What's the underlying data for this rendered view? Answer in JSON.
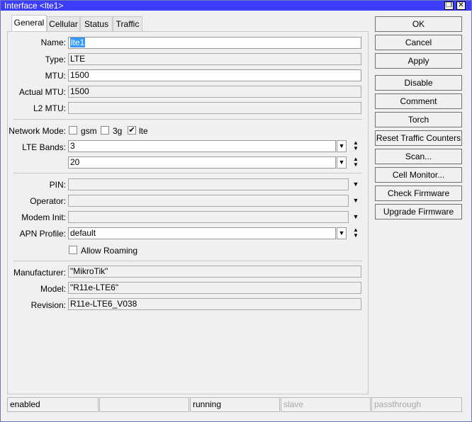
{
  "window": {
    "title": "Interface <lte1>",
    "restore_glyph": "❐",
    "close_glyph": "✕"
  },
  "tabs": [
    {
      "label": "General"
    },
    {
      "label": "Cellular"
    },
    {
      "label": "Status"
    },
    {
      "label": "Traffic"
    }
  ],
  "general": {
    "name": {
      "label": "Name:",
      "value": "lte1"
    },
    "type": {
      "label": "Type:",
      "value": "LTE"
    },
    "mtu": {
      "label": "MTU:",
      "value": "1500"
    },
    "actual_mtu": {
      "label": "Actual MTU:",
      "value": "1500"
    },
    "l2_mtu": {
      "label": "L2 MTU:",
      "value": ""
    },
    "network_mode": {
      "label": "Network Mode:",
      "options": [
        {
          "label": "gsm",
          "checked": false
        },
        {
          "label": "3g",
          "checked": false
        },
        {
          "label": "lte",
          "checked": true
        }
      ]
    },
    "lte_bands": {
      "label": "LTE Bands:",
      "values": [
        "3",
        "20"
      ]
    },
    "pin": {
      "label": "PIN:",
      "value": ""
    },
    "operator": {
      "label": "Operator:",
      "value": ""
    },
    "modem_init": {
      "label": "Modem Init:",
      "value": ""
    },
    "apn_profile": {
      "label": "APN Profile:",
      "value": "default"
    },
    "allow_roaming": {
      "label": "Allow Roaming",
      "checked": false
    },
    "manufacturer": {
      "label": "Manufacturer:",
      "value": "\"MikroTik\""
    },
    "model": {
      "label": "Model:",
      "value": "\"R11e-LTE6\""
    },
    "revision": {
      "label": "Revision:",
      "value": "R11e-LTE6_V038"
    }
  },
  "buttons": [
    {
      "label": "OK"
    },
    {
      "label": "Cancel"
    },
    {
      "label": "Apply"
    },
    {
      "label": "Disable"
    },
    {
      "label": "Comment"
    },
    {
      "label": "Torch"
    },
    {
      "label": "Reset Traffic Counters"
    },
    {
      "label": "Scan..."
    },
    {
      "label": "Cell Monitor..."
    },
    {
      "label": "Check Firmware"
    },
    {
      "label": "Upgrade Firmware"
    }
  ],
  "statusbar": [
    "enabled",
    "",
    "running",
    "slave",
    "passthrough"
  ],
  "icons": {
    "dropdown": "dropdown-arrow-icon",
    "updown": "up-down-arrows-icon",
    "check": "checkmark-icon"
  }
}
